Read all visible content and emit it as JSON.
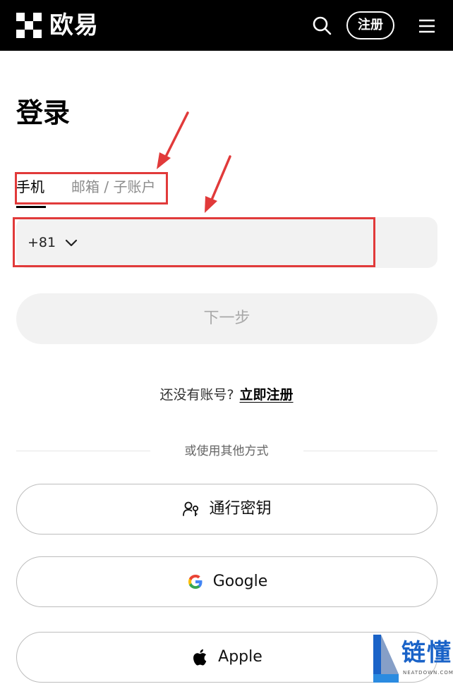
{
  "header": {
    "brand": "欧易",
    "register_label": "注册",
    "search_icon": "search-icon",
    "menu_icon": "menu-icon",
    "colors": {
      "background": "#000000",
      "foreground": "#ffffff"
    }
  },
  "page": {
    "title": "登录"
  },
  "tabs": [
    {
      "label": "手机",
      "active": true
    },
    {
      "label": "邮箱 / 子账户",
      "active": false
    }
  ],
  "phone": {
    "country_code": "+81",
    "chevron_icon": "chevron-down-icon"
  },
  "next_button": {
    "label": "下一步",
    "enabled": false
  },
  "no_account": {
    "text": "还没有账号?",
    "link": "立即注册"
  },
  "divider": {
    "text": "或使用其他方式"
  },
  "alt_logins": [
    {
      "label": "通行密钥",
      "icon": "passkey-icon"
    },
    {
      "label": "Google",
      "icon": "google-icon"
    },
    {
      "label": "Apple",
      "icon": "apple-icon"
    }
  ],
  "watermark": {
    "text": "链懂",
    "subtext": "NEATDOWN.COM"
  },
  "colors": {
    "annotation": "#e13a3a",
    "input_bg": "#f2f2f2",
    "muted": "#8c8c8c",
    "watermark": "#1a63c8"
  }
}
